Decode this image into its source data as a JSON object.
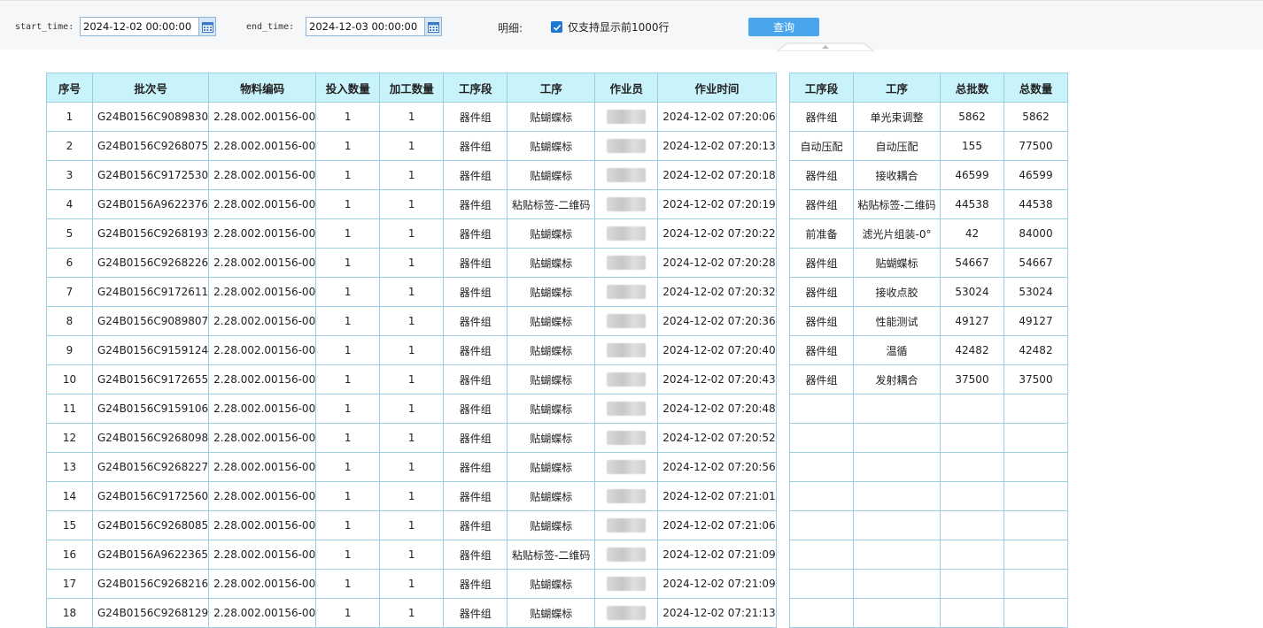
{
  "filters": {
    "start_label": "start_time:",
    "start_value": "2024-12-02 00:00:00",
    "end_label": "end_time:",
    "end_value": "2024-12-03 00:00:00",
    "detail_label": "明细:",
    "only_top_label": "仅支持显示前1000行",
    "query_label": "查询"
  },
  "main_table": {
    "headers": [
      "序号",
      "批次号",
      "物料编码",
      "投入数量",
      "加工数量",
      "工序段",
      "工序",
      "作业员",
      "作业时间"
    ],
    "rows": [
      [
        "1",
        "G24B0156C9089830",
        "2.28.002.00156-00",
        "1",
        "1",
        "器件组",
        "贴蝴蝶标",
        "",
        "2024-12-02 07:20:06"
      ],
      [
        "2",
        "G24B0156C9268075",
        "2.28.002.00156-00",
        "1",
        "1",
        "器件组",
        "贴蝴蝶标",
        "",
        "2024-12-02 07:20:13"
      ],
      [
        "3",
        "G24B0156C9172530",
        "2.28.002.00156-00",
        "1",
        "1",
        "器件组",
        "贴蝴蝶标",
        "",
        "2024-12-02 07:20:18"
      ],
      [
        "4",
        "G24B0156A9622376",
        "2.28.002.00156-00",
        "1",
        "1",
        "器件组",
        "粘贴标签-二维码",
        "",
        "2024-12-02 07:20:19"
      ],
      [
        "5",
        "G24B0156C9268193",
        "2.28.002.00156-00",
        "1",
        "1",
        "器件组",
        "贴蝴蝶标",
        "",
        "2024-12-02 07:20:22"
      ],
      [
        "6",
        "G24B0156C9268226",
        "2.28.002.00156-00",
        "1",
        "1",
        "器件组",
        "贴蝴蝶标",
        "",
        "2024-12-02 07:20:28"
      ],
      [
        "7",
        "G24B0156C9172611",
        "2.28.002.00156-00",
        "1",
        "1",
        "器件组",
        "贴蝴蝶标",
        "",
        "2024-12-02 07:20:32"
      ],
      [
        "8",
        "G24B0156C9089807",
        "2.28.002.00156-00",
        "1",
        "1",
        "器件组",
        "贴蝴蝶标",
        "",
        "2024-12-02 07:20:36"
      ],
      [
        "9",
        "G24B0156C9159124",
        "2.28.002.00156-00",
        "1",
        "1",
        "器件组",
        "贴蝴蝶标",
        "",
        "2024-12-02 07:20:40"
      ],
      [
        "10",
        "G24B0156C9172655",
        "2.28.002.00156-00",
        "1",
        "1",
        "器件组",
        "贴蝴蝶标",
        "",
        "2024-12-02 07:20:43"
      ],
      [
        "11",
        "G24B0156C9159106",
        "2.28.002.00156-00",
        "1",
        "1",
        "器件组",
        "贴蝴蝶标",
        "",
        "2024-12-02 07:20:48"
      ],
      [
        "12",
        "G24B0156C9268098",
        "2.28.002.00156-00",
        "1",
        "1",
        "器件组",
        "贴蝴蝶标",
        "",
        "2024-12-02 07:20:52"
      ],
      [
        "13",
        "G24B0156C9268227",
        "2.28.002.00156-00",
        "1",
        "1",
        "器件组",
        "贴蝴蝶标",
        "",
        "2024-12-02 07:20:56"
      ],
      [
        "14",
        "G24B0156C9172560",
        "2.28.002.00156-00",
        "1",
        "1",
        "器件组",
        "贴蝴蝶标",
        "",
        "2024-12-02 07:21:01"
      ],
      [
        "15",
        "G24B0156C9268085",
        "2.28.002.00156-00",
        "1",
        "1",
        "器件组",
        "贴蝴蝶标",
        "",
        "2024-12-02 07:21:06"
      ],
      [
        "16",
        "G24B0156A9622365",
        "2.28.002.00156-00",
        "1",
        "1",
        "器件组",
        "粘贴标签-二维码",
        "",
        "2024-12-02 07:21:09"
      ],
      [
        "17",
        "G24B0156C9268216",
        "2.28.002.00156-00",
        "1",
        "1",
        "器件组",
        "贴蝴蝶标",
        "",
        "2024-12-02 07:21:09"
      ],
      [
        "18",
        "G24B0156C9268129",
        "2.28.002.00156-00",
        "1",
        "1",
        "器件组",
        "贴蝴蝶标",
        "",
        "2024-12-02 07:21:13"
      ]
    ]
  },
  "summary_table": {
    "headers": [
      "工序段",
      "工序",
      "总批数",
      "总数量"
    ],
    "rows": [
      [
        "器件组",
        "单光束调整",
        "5862",
        "5862"
      ],
      [
        "自动压配",
        "自动压配",
        "155",
        "77500"
      ],
      [
        "器件组",
        "接收耦合",
        "46599",
        "46599"
      ],
      [
        "器件组",
        "粘贴标签-二维码",
        "44538",
        "44538"
      ],
      [
        "前准备",
        "滤光片组装-0°",
        "42",
        "84000"
      ],
      [
        "器件组",
        "贴蝴蝶标",
        "54667",
        "54667"
      ],
      [
        "器件组",
        "接收点胶",
        "53024",
        "53024"
      ],
      [
        "器件组",
        "性能测试",
        "49127",
        "49127"
      ],
      [
        "器件组",
        "温循",
        "42482",
        "42482"
      ],
      [
        "器件组",
        "发射耦合",
        "37500",
        "37500"
      ]
    ],
    "empty_rows": 8
  },
  "colors": {
    "header_bg": "#c9f3fb",
    "border": "#9ccfe4",
    "query_button": "#4aa6ec",
    "checkbox": "#1e78d2"
  },
  "icons": {
    "calendar": "calendar-icon",
    "check": "check-icon"
  }
}
